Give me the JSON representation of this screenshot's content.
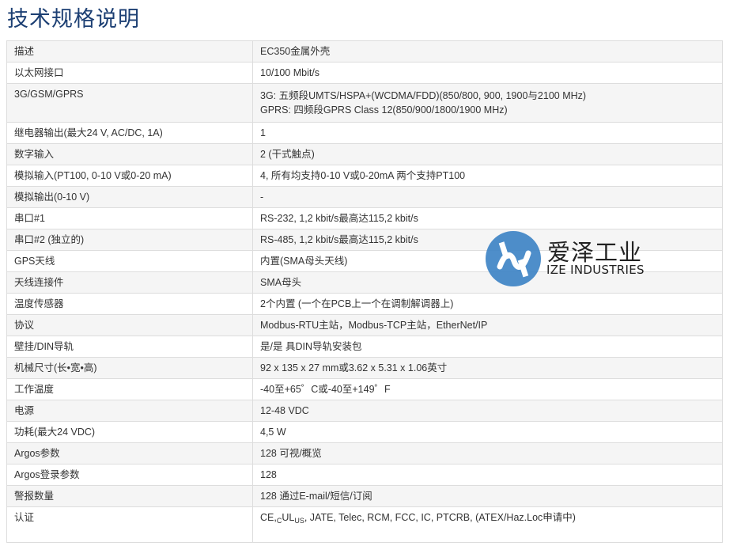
{
  "page": {
    "title": "技术规格说明"
  },
  "specs": {
    "rows": [
      {
        "label": "描述",
        "values": [
          "EC350金属外壳"
        ]
      },
      {
        "label": "以太网接口",
        "values": [
          "10/100 Mbit/s"
        ]
      },
      {
        "label": "3G/GSM/GPRS",
        "values": [
          "3G: 五频段UMTS/HSPA+(WCDMA/FDD)(850/800, 900, 1900与2100 MHz)",
          "GPRS: 四频段GPRS Class 12(850/900/1800/1900 MHz)"
        ]
      },
      {
        "label": "继电器输出(最大24 V, AC/DC, 1A)",
        "values": [
          "1"
        ]
      },
      {
        "label": "数字输入",
        "values": [
          "2 (干式触点)"
        ]
      },
      {
        "label": "模拟输入(PT100, 0-10 V或0-20 mA)",
        "values": [
          "4, 所有均支持0-10 V或0-20mA 两个支持PT100"
        ]
      },
      {
        "label": "模拟输出(0-10 V)",
        "values": [
          "-"
        ]
      },
      {
        "label": "串口#1",
        "values": [
          "RS-232, 1,2 kbit/s最高达115,2 kbit/s"
        ]
      },
      {
        "label": "串口#2 (独立的)",
        "values": [
          "RS-485, 1,2 kbit/s最高达115,2 kbit/s"
        ]
      },
      {
        "label": "GPS天线",
        "values": [
          "内置(SMA母头天线)"
        ]
      },
      {
        "label": "天线连接件",
        "values": [
          "SMA母头"
        ]
      },
      {
        "label": "温度传感器",
        "values": [
          "2个内置 (一个在PCB上一个在调制解调器上)"
        ]
      },
      {
        "label": "协议",
        "values": [
          "Modbus-RTU主站，Modbus-TCP主站，EtherNet/IP"
        ]
      },
      {
        "label": "壁挂/DIN导轨",
        "values": [
          "是/是 具DIN导轨安装包"
        ]
      },
      {
        "label": "机械尺寸(长•宽•高)",
        "values": [
          "92 x 135 x 27 mm或3.62 x 5.31 x 1.06英寸"
        ]
      },
      {
        "label": "工作温度",
        "values": [
          "-40至+65゜C或-40至+149゜F"
        ]
      },
      {
        "label": "电源",
        "values": [
          "12-48 VDC"
        ]
      },
      {
        "label": "功耗(最大24 VDC)",
        "values": [
          "4,5 W"
        ]
      },
      {
        "label": "Argos参数",
        "values": [
          "128 可视/概览"
        ]
      },
      {
        "label": "Argos登录参数",
        "values": [
          "128"
        ]
      },
      {
        "label": "警报数量",
        "values": [
          "128 通过E-mail/短信/订阅"
        ]
      },
      {
        "label": "认证",
        "values": []
      }
    ],
    "certification": {
      "ce": "CE,",
      "c": "C",
      "ul": "UL",
      "us": "US",
      "rest": ", JATE, Telec, RCM, FCC, IC, PTCRB, (ATEX/Haz.Loc申请中)"
    }
  },
  "watermark": {
    "name_cn": "爱泽工业",
    "name_en": "IZE INDUSTRIES",
    "logo_icon": "ize-logo-icon",
    "color_logo": "#3b82c4"
  }
}
